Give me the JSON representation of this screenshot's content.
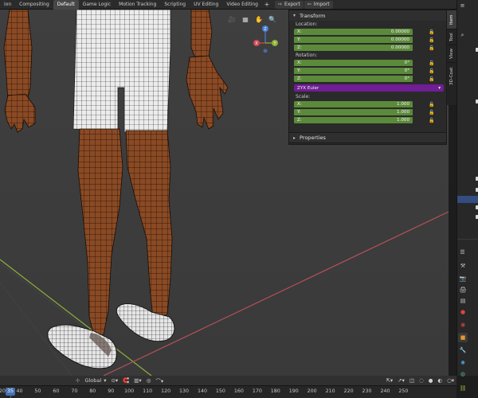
{
  "workspace_tabs": [
    {
      "label": "ion"
    },
    {
      "label": "Compositing"
    },
    {
      "label": "Default",
      "active": true
    },
    {
      "label": "Game Logic"
    },
    {
      "label": "Motion Tracking"
    },
    {
      "label": "Scripting"
    },
    {
      "label": "UV Editing"
    },
    {
      "label": "Video Editing"
    }
  ],
  "topbar": {
    "add_label": "+",
    "export_label": "Export",
    "import_label": "Import"
  },
  "side_tabs": [
    {
      "label": "Item",
      "active": true
    },
    {
      "label": "Tool"
    },
    {
      "label": "View"
    },
    {
      "label": "3D-Coat"
    }
  ],
  "transform_panel": {
    "title": "Transform",
    "location": {
      "label": "Location:",
      "x": {
        "axis": "X:",
        "value": "0.00000"
      },
      "y": {
        "axis": "Y:",
        "value": "0.00000"
      },
      "z": {
        "axis": "Z:",
        "value": "0.00000"
      }
    },
    "rotation": {
      "label": "Rotation:",
      "x": {
        "axis": "X:",
        "value": "0°"
      },
      "y": {
        "axis": "Y:",
        "value": "0°"
      },
      "z": {
        "axis": "Z:",
        "value": "0°"
      }
    },
    "rotation_mode": "ZYX Euler",
    "scale": {
      "label": "Scale:",
      "x": {
        "axis": "X:",
        "value": "1.000"
      },
      "y": {
        "axis": "Y:",
        "value": "1.000"
      },
      "z": {
        "axis": "Z:",
        "value": "1.000"
      }
    }
  },
  "properties_panel": {
    "title": "Properties"
  },
  "gizmo": {
    "x_label": "X",
    "y_label": "Y",
    "z_label": "Z"
  },
  "bottom_toolbar": {
    "orientation": "Global"
  },
  "timeline": {
    "current_frame": "35",
    "ticks": [
      "20",
      "40",
      "50",
      "60",
      "70",
      "80",
      "90",
      "100",
      "110",
      "120",
      "130",
      "140",
      "150",
      "160",
      "170",
      "180",
      "190",
      "200",
      "210",
      "220",
      "230",
      "240",
      "250"
    ]
  },
  "colors": {
    "field_green": "#5b8a3a",
    "enum_purple": "#6f1e93",
    "accent_blue": "#4772b3",
    "skin": "#8a4a24"
  }
}
